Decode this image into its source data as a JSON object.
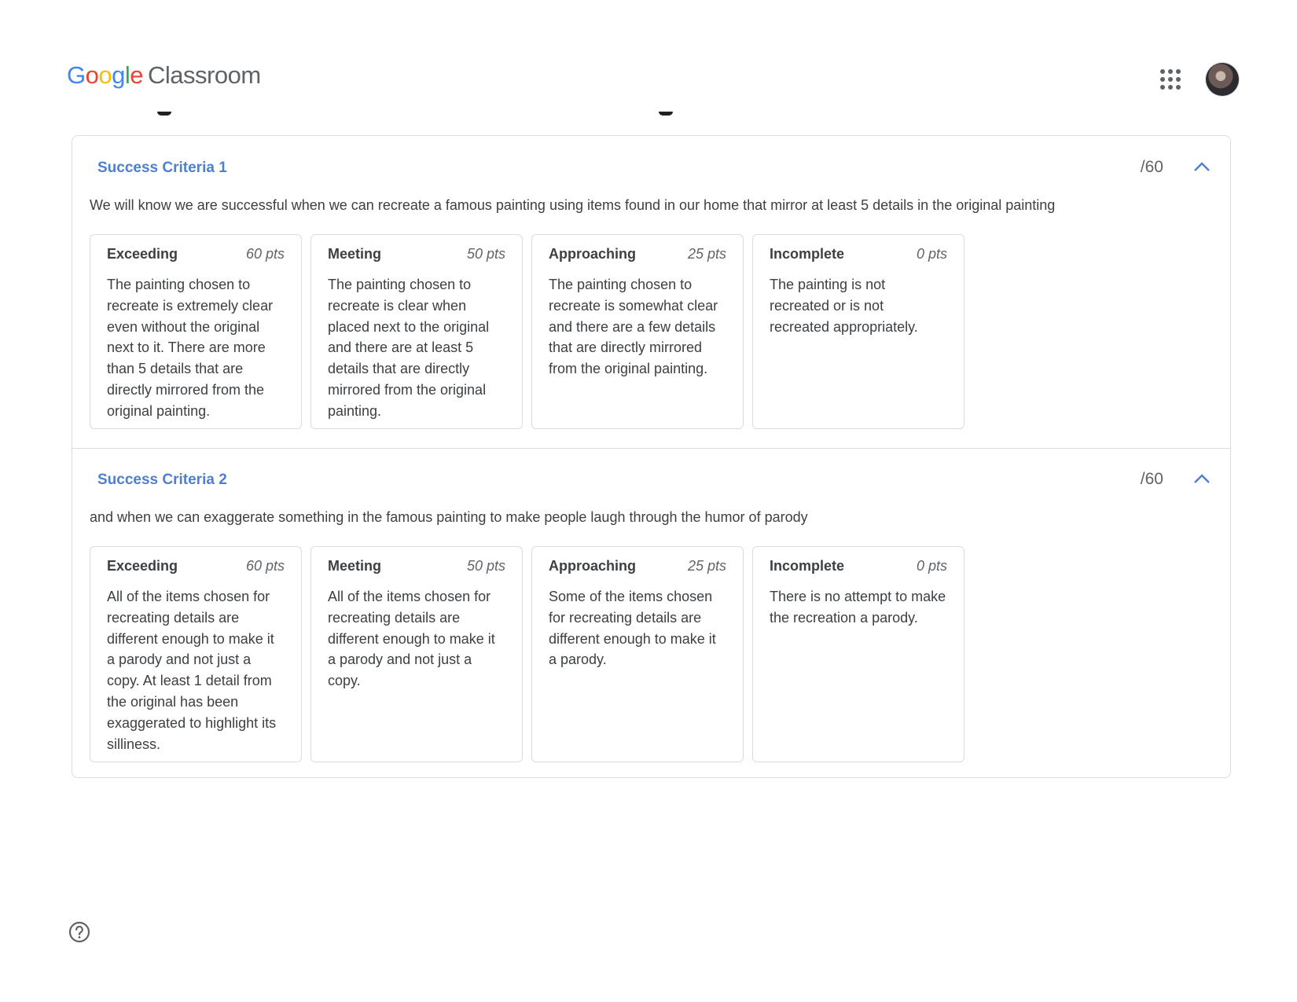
{
  "header": {
    "logo_letters": [
      "G",
      "o",
      "o",
      "g",
      "l",
      "e"
    ],
    "product": "Classroom",
    "apps_icon": "apps-grid-icon",
    "avatar_icon": "user-avatar"
  },
  "criteria": [
    {
      "title": "Success Criteria 1",
      "points": "/60",
      "description": "We will know we are successful when we can recreate a famous painting using items found in our home that mirror at least 5 details in the original painting",
      "levels": [
        {
          "name": "Exceeding",
          "pts": "60 pts",
          "desc": "The painting chosen to recreate is extremely clear even without the original next to it. There are more than 5 details that are directly mirrored from the original painting."
        },
        {
          "name": "Meeting",
          "pts": "50 pts",
          "desc": "The painting chosen to recreate is clear when placed next to the original and there are at least 5 details that are directly mirrored from the original painting."
        },
        {
          "name": "Approaching",
          "pts": "25 pts",
          "desc": "The painting chosen to recreate is somewhat clear and there are a few details that are directly mirrored from the original painting."
        },
        {
          "name": "Incomplete",
          "pts": "0 pts",
          "desc": "The painting is not recreated or is not recreated appropriately."
        }
      ]
    },
    {
      "title": "Success Criteria 2",
      "points": "/60",
      "description": "and when we can exaggerate something in the famous painting to make people laugh through the humor of parody",
      "levels": [
        {
          "name": "Exceeding",
          "pts": "60 pts",
          "desc": "All of the items chosen for recreating details are different enough to make it a parody and not just a copy. At least 1 detail from the original has been exaggerated to highlight its silliness."
        },
        {
          "name": "Meeting",
          "pts": "50 pts",
          "desc": "All of the items chosen for recreating details are different enough to make it a parody and not just a copy."
        },
        {
          "name": "Approaching",
          "pts": "25 pts",
          "desc": "Some of the items chosen for recreating details are different enough to make it a parody."
        },
        {
          "name": "Incomplete",
          "pts": "0 pts",
          "desc": "There is no attempt to make the recreation a parody."
        }
      ]
    }
  ],
  "footer": {
    "help_icon": "help-circle-icon"
  }
}
